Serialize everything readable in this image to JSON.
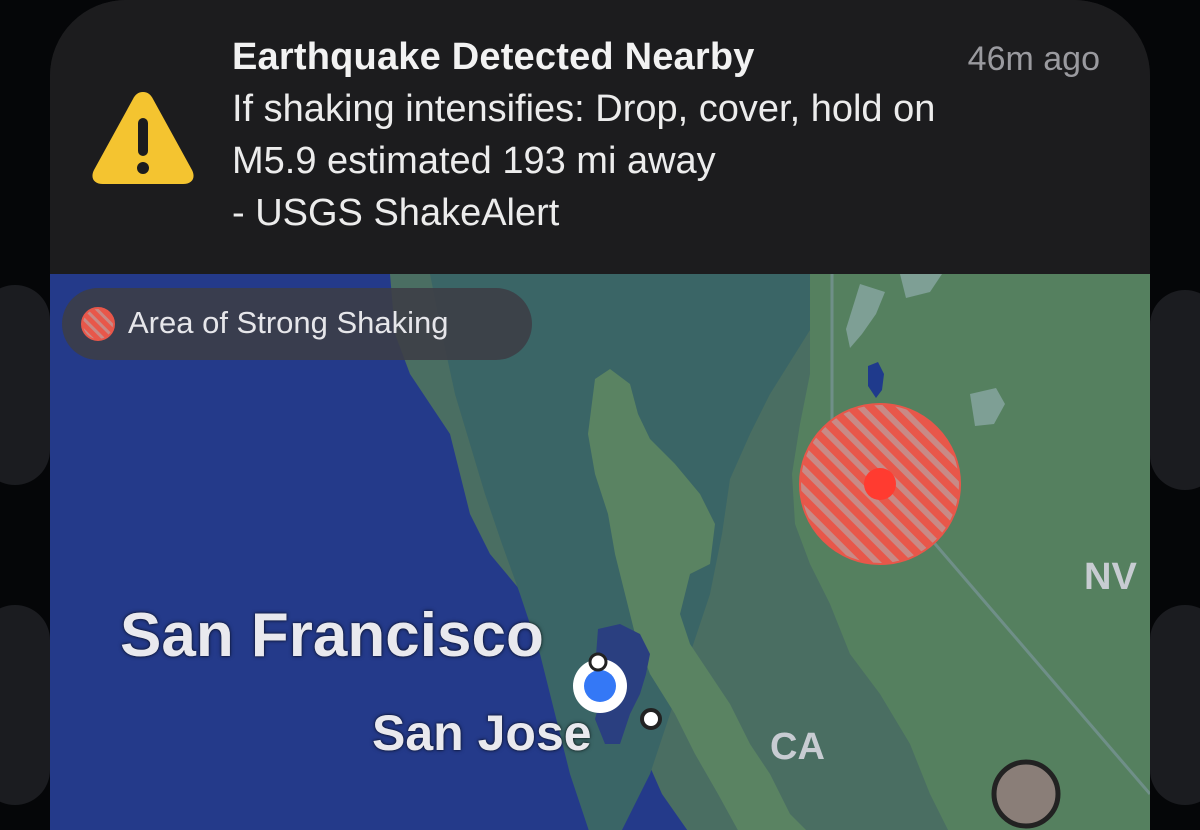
{
  "notification": {
    "title": "Earthquake Detected Nearby",
    "time": "46m ago",
    "lines": [
      "If shaking intensifies: Drop, cover, hold on",
      "M5.9 estimated 193 mi away",
      "- USGS ShakeAlert"
    ],
    "icon": "warning-triangle-icon",
    "icon_color": "#f4c430"
  },
  "map": {
    "legend": {
      "label": "Area of Strong Shaking",
      "icon": "strong-shaking-hatched-dot-icon"
    },
    "cities": {
      "san_francisco": "San Francisco",
      "san_jose": "San Jose"
    },
    "states": {
      "california": "CA",
      "nevada": "NV"
    },
    "colors": {
      "ocean": "#243a8a",
      "land": "#4a6e62",
      "shaking_area": "#e8574a",
      "epicenter": "#ff3b30",
      "user_location": "#3478f6"
    }
  }
}
